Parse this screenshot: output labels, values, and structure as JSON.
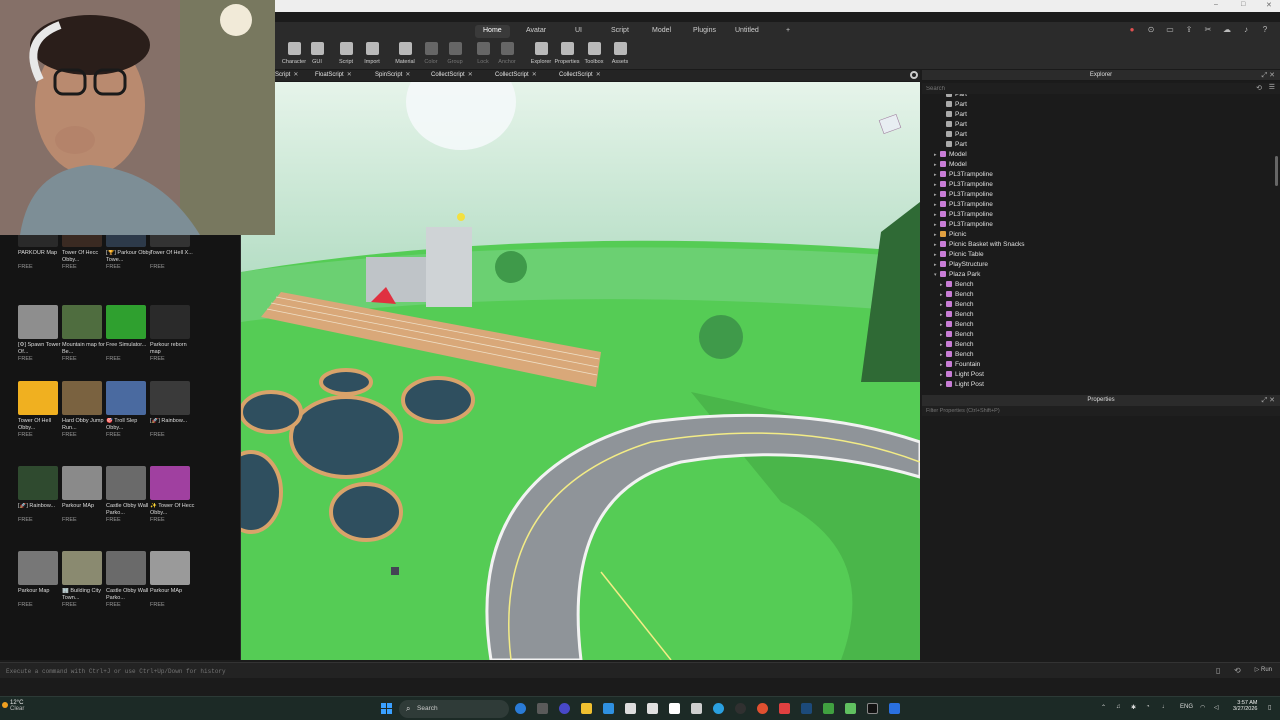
{
  "menu": {
    "tabs": [
      {
        "label": "Home",
        "active": true
      },
      {
        "label": "Avatar",
        "active": false
      },
      {
        "label": "UI",
        "active": false
      },
      {
        "label": "Script",
        "active": false
      },
      {
        "label": "Model",
        "active": false
      },
      {
        "label": "Plugins",
        "active": false
      },
      {
        "label": "Untitled",
        "active": false
      },
      {
        "label": "+",
        "active": false
      }
    ]
  },
  "toolbar": {
    "tools": [
      {
        "label": "Character",
        "icon": "character-icon",
        "enabled": true
      },
      {
        "label": "GUI",
        "icon": "gui-icon",
        "enabled": true
      },
      {
        "label": "Script",
        "icon": "script-icon",
        "enabled": true
      },
      {
        "label": "Import",
        "icon": "import-icon",
        "enabled": true
      },
      {
        "label": "Material",
        "icon": "material-icon",
        "enabled": true
      },
      {
        "label": "Color",
        "icon": "color-icon",
        "enabled": false
      },
      {
        "label": "Group",
        "icon": "group-icon",
        "enabled": false
      },
      {
        "label": "Lock",
        "icon": "lock-icon",
        "enabled": false
      },
      {
        "label": "Anchor",
        "icon": "anchor-icon",
        "enabled": false
      },
      {
        "label": "Explorer",
        "icon": "explorer-icon",
        "enabled": true
      },
      {
        "label": "Properties",
        "icon": "properties-icon",
        "enabled": true
      },
      {
        "label": "Toolbox",
        "icon": "toolbox-icon",
        "enabled": true
      },
      {
        "label": "Assets",
        "icon": "assets-icon",
        "enabled": true
      }
    ]
  },
  "script_tabs": [
    "Script",
    "FloatScript",
    "SpinScript",
    "CollectScript",
    "CollectScript",
    "CollectScript"
  ],
  "toolbox": {
    "items": [
      {
        "name": "PARKOUR Map",
        "price": "FREE",
        "color": "#2a2a2a"
      },
      {
        "name": "Tower Of Hecc Obby...",
        "price": "FREE",
        "color": "#3a2a22"
      },
      {
        "name": "[🏆] Parkour Obby Towe...",
        "price": "FREE",
        "color": "#2d3a4a"
      },
      {
        "name": "Tower Of Hell X...",
        "price": "FREE",
        "color": "#333333"
      },
      {
        "name": "[⚙] Spawn Tower Of...",
        "price": "FREE",
        "color": "#8e8e8e"
      },
      {
        "name": "Mountain map for Be...",
        "price": "FREE",
        "color": "#4f6d3f"
      },
      {
        "name": "Free Simulator...",
        "price": "FREE",
        "color": "#2fa02f"
      },
      {
        "name": "Parkour reborn map",
        "price": "FREE",
        "color": "#2a2a2a"
      },
      {
        "name": "Tower Of Hell Obby...",
        "price": "FREE",
        "color": "#f0b020"
      },
      {
        "name": "Hard Obby Jump Run...",
        "price": "FREE",
        "color": "#7a6240"
      },
      {
        "name": "🎯 Troll Slep Obby...",
        "price": "FREE",
        "color": "#4a6aa0"
      },
      {
        "name": "[🚀] Rainbow...",
        "price": "FREE",
        "color": "#3a3a3a"
      },
      {
        "name": "[🚀] Rainbow...",
        "price": "FREE",
        "color": "#2f4a2f"
      },
      {
        "name": "Parkour MAp",
        "price": "FREE",
        "color": "#8a8a8a"
      },
      {
        "name": "Castle Obby Wall Parko...",
        "price": "FREE",
        "color": "#6a6a6a"
      },
      {
        "name": "✨ Tower Of Hecc Obby...",
        "price": "FREE",
        "color": "#a040a0"
      },
      {
        "name": "Parkour Map",
        "price": "FREE",
        "color": "#777777"
      },
      {
        "name": "🏢 Building City Town...",
        "price": "FREE",
        "color": "#8a8a70"
      },
      {
        "name": "Castle Obby Wall Parko...",
        "price": "FREE",
        "color": "#6a6a6a"
      },
      {
        "name": "Parkour MAp",
        "price": "FREE",
        "color": "#9a9a9a"
      }
    ]
  },
  "explorer": {
    "title": "Explorer",
    "search_placeholder": "Search",
    "nodes": [
      {
        "label": "Part",
        "indent": 2,
        "caret": "",
        "icon": "part-icon",
        "color": "#aaaaaa"
      },
      {
        "label": "Part",
        "indent": 2,
        "caret": "",
        "icon": "part-icon",
        "color": "#aaaaaa"
      },
      {
        "label": "Part",
        "indent": 2,
        "caret": "",
        "icon": "part-icon",
        "color": "#aaaaaa"
      },
      {
        "label": "Part",
        "indent": 2,
        "caret": "",
        "icon": "part-icon",
        "color": "#aaaaaa"
      },
      {
        "label": "Part",
        "indent": 2,
        "caret": "",
        "icon": "part-icon",
        "color": "#aaaaaa"
      },
      {
        "label": "Part",
        "indent": 2,
        "caret": "",
        "icon": "part-icon",
        "color": "#aaaaaa"
      },
      {
        "label": "Model",
        "indent": 1,
        "caret": "▸",
        "icon": "model-icon",
        "color": "#c87dd6"
      },
      {
        "label": "Model",
        "indent": 1,
        "caret": "▸",
        "icon": "model-icon",
        "color": "#c87dd6"
      },
      {
        "label": "PL3Trampoline",
        "indent": 1,
        "caret": "▸",
        "icon": "model-icon",
        "color": "#c87dd6"
      },
      {
        "label": "PL3Trampoline",
        "indent": 1,
        "caret": "▸",
        "icon": "model-icon",
        "color": "#c87dd6"
      },
      {
        "label": "PL3Trampoline",
        "indent": 1,
        "caret": "▸",
        "icon": "model-icon",
        "color": "#c87dd6"
      },
      {
        "label": "PL3Trampoline",
        "indent": 1,
        "caret": "▸",
        "icon": "model-icon",
        "color": "#c87dd6"
      },
      {
        "label": "PL3Trampoline",
        "indent": 1,
        "caret": "▸",
        "icon": "model-icon",
        "color": "#c87dd6"
      },
      {
        "label": "PL3Trampoline",
        "indent": 1,
        "caret": "▸",
        "icon": "model-icon",
        "color": "#c87dd6"
      },
      {
        "label": "Picnic",
        "indent": 1,
        "caret": "▸",
        "icon": "folder-icon",
        "color": "#e0a040"
      },
      {
        "label": "Picnic Basket with Snacks",
        "indent": 1,
        "caret": "▸",
        "icon": "model-icon",
        "color": "#c87dd6"
      },
      {
        "label": "Picnic Table",
        "indent": 1,
        "caret": "▸",
        "icon": "model-icon",
        "color": "#c87dd6"
      },
      {
        "label": "PlayStructure",
        "indent": 1,
        "caret": "▸",
        "icon": "model-icon",
        "color": "#c87dd6"
      },
      {
        "label": "Plaza Park",
        "indent": 1,
        "caret": "▾",
        "icon": "model-icon",
        "color": "#c87dd6"
      },
      {
        "label": "Bench",
        "indent": 2,
        "caret": "▸",
        "icon": "model-icon",
        "color": "#c87dd6"
      },
      {
        "label": "Bench",
        "indent": 2,
        "caret": "▸",
        "icon": "model-icon",
        "color": "#c87dd6"
      },
      {
        "label": "Bench",
        "indent": 2,
        "caret": "▸",
        "icon": "model-icon",
        "color": "#c87dd6"
      },
      {
        "label": "Bench",
        "indent": 2,
        "caret": "▸",
        "icon": "model-icon",
        "color": "#c87dd6"
      },
      {
        "label": "Bench",
        "indent": 2,
        "caret": "▸",
        "icon": "model-icon",
        "color": "#c87dd6"
      },
      {
        "label": "Bench",
        "indent": 2,
        "caret": "▸",
        "icon": "model-icon",
        "color": "#c87dd6"
      },
      {
        "label": "Bench",
        "indent": 2,
        "caret": "▸",
        "icon": "model-icon",
        "color": "#c87dd6"
      },
      {
        "label": "Bench",
        "indent": 2,
        "caret": "▸",
        "icon": "model-icon",
        "color": "#c87dd6"
      },
      {
        "label": "Fountain",
        "indent": 2,
        "caret": "▸",
        "icon": "model-icon",
        "color": "#c87dd6"
      },
      {
        "label": "Light Post",
        "indent": 2,
        "caret": "▸",
        "icon": "model-icon",
        "color": "#c87dd6"
      },
      {
        "label": "Light Post",
        "indent": 2,
        "caret": "▸",
        "icon": "model-icon",
        "color": "#c87dd6"
      }
    ]
  },
  "properties": {
    "title": "Properties",
    "filter_placeholder": "Filter Properties (Ctrl+Shift+P)"
  },
  "command_bar": {
    "placeholder": "Execute a command with Ctrl+J or use Ctrl+Up/Down for history",
    "run_label": "Run"
  },
  "taskbar": {
    "weather_temp": "12°C",
    "weather_cond": "Clear",
    "search_label": "Search",
    "lang": "ENG",
    "time": "3:57 AM",
    "date": "3/27/2026"
  },
  "colors": {
    "accent": "#3aa0ff",
    "panel": "#1b1b1b",
    "grass": "#4ec74e",
    "sky": "#cfe9dd",
    "road": "#8f9499"
  }
}
